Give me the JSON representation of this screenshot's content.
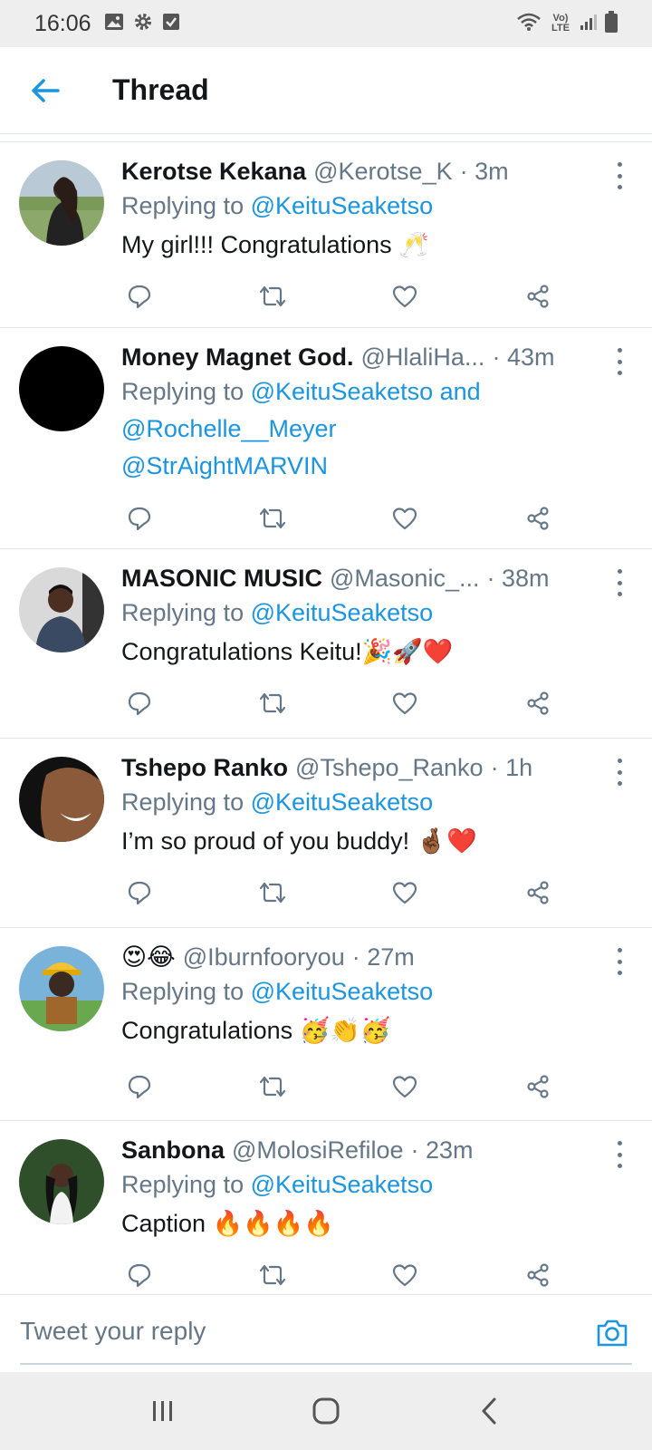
{
  "status_bar": {
    "time": "16:06",
    "network": "Vo) LTE"
  },
  "header": {
    "title": "Thread"
  },
  "tweets": [
    {
      "name": "Kerotse Kekana",
      "handle": "@Kerotse_K",
      "time": "· 3m",
      "replying_prefix": "Replying to ",
      "mentions": [
        "@KeituSeaketso"
      ],
      "text": "My girl!!! Congratulations 🥂"
    },
    {
      "name": "Money Magnet God.",
      "handle": "@HlaliHa...",
      "time": "· 43m",
      "replying_prefix": "Replying to ",
      "mentions": [
        "@KeituSeaketso",
        "@Rochelle__Meyer",
        "@StrAightMARVIN"
      ],
      "mention_joiner": " and",
      "text": ""
    },
    {
      "name": "MASONIC MUSIC",
      "handle": "@Masonic_...",
      "time": "· 38m",
      "replying_prefix": "Replying to ",
      "mentions": [
        "@KeituSeaketso"
      ],
      "text": "Congratulations Keitu!🎉🚀❤️"
    },
    {
      "name": "Tshepo Ranko",
      "handle": "@Tshepo_Ranko",
      "time": "· 1h",
      "replying_prefix": "Replying to ",
      "mentions": [
        "@KeituSeaketso"
      ],
      "text": "I’m so proud of you buddy! 🤞🏾❤️"
    },
    {
      "name": "😍😂",
      "handle": "@Iburnfooryou",
      "time": "· 27m",
      "replying_prefix": "Replying to ",
      "mentions": [
        "@KeituSeaketso"
      ],
      "text": "Congratulations 🥳👏🥳"
    },
    {
      "name": "Sanbona",
      "handle": "@MolosiRefiloe",
      "time": "· 23m",
      "replying_prefix": "Replying to ",
      "mentions": [
        "@KeituSeaketso"
      ],
      "text": "Caption 🔥🔥🔥🔥"
    }
  ],
  "composer": {
    "placeholder": "Tweet your reply"
  },
  "colors": {
    "accent": "#1b95e0",
    "secondary_text": "#657786",
    "primary_text": "#14171a",
    "divider": "#e1e8ed"
  },
  "icons": {
    "back": "arrow-left-icon",
    "reply": "reply-icon",
    "retweet": "retweet-icon",
    "like": "heart-icon",
    "share": "share-icon",
    "camera": "camera-icon",
    "more": "more-vertical-icon"
  }
}
